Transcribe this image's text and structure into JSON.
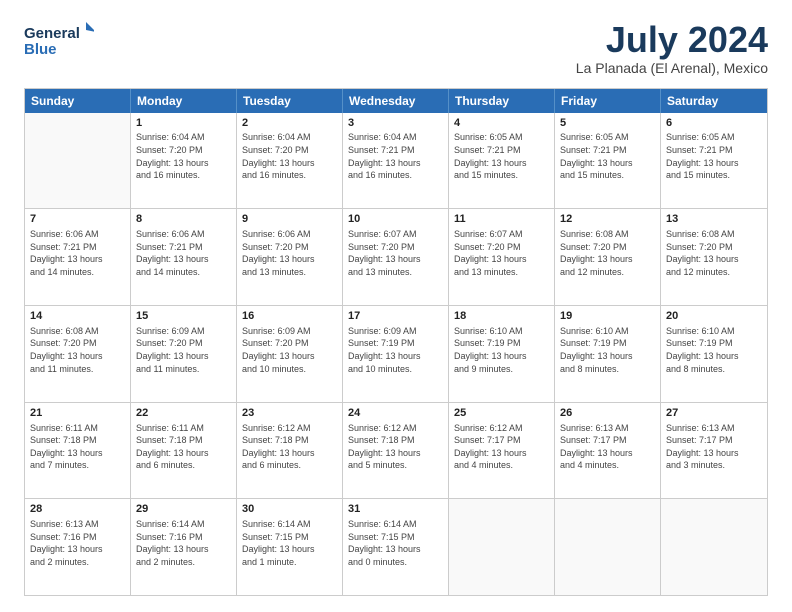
{
  "header": {
    "logo_line1": "General",
    "logo_line2": "Blue",
    "month_title": "July 2024",
    "location": "La Planada (El Arenal), Mexico"
  },
  "days": [
    "Sunday",
    "Monday",
    "Tuesday",
    "Wednesday",
    "Thursday",
    "Friday",
    "Saturday"
  ],
  "weeks": [
    [
      {
        "day": "",
        "info": ""
      },
      {
        "day": "1",
        "info": "Sunrise: 6:04 AM\nSunset: 7:20 PM\nDaylight: 13 hours\nand 16 minutes."
      },
      {
        "day": "2",
        "info": "Sunrise: 6:04 AM\nSunset: 7:20 PM\nDaylight: 13 hours\nand 16 minutes."
      },
      {
        "day": "3",
        "info": "Sunrise: 6:04 AM\nSunset: 7:21 PM\nDaylight: 13 hours\nand 16 minutes."
      },
      {
        "day": "4",
        "info": "Sunrise: 6:05 AM\nSunset: 7:21 PM\nDaylight: 13 hours\nand 15 minutes."
      },
      {
        "day": "5",
        "info": "Sunrise: 6:05 AM\nSunset: 7:21 PM\nDaylight: 13 hours\nand 15 minutes."
      },
      {
        "day": "6",
        "info": "Sunrise: 6:05 AM\nSunset: 7:21 PM\nDaylight: 13 hours\nand 15 minutes."
      }
    ],
    [
      {
        "day": "7",
        "info": "Sunrise: 6:06 AM\nSunset: 7:21 PM\nDaylight: 13 hours\nand 14 minutes."
      },
      {
        "day": "8",
        "info": "Sunrise: 6:06 AM\nSunset: 7:21 PM\nDaylight: 13 hours\nand 14 minutes."
      },
      {
        "day": "9",
        "info": "Sunrise: 6:06 AM\nSunset: 7:20 PM\nDaylight: 13 hours\nand 13 minutes."
      },
      {
        "day": "10",
        "info": "Sunrise: 6:07 AM\nSunset: 7:20 PM\nDaylight: 13 hours\nand 13 minutes."
      },
      {
        "day": "11",
        "info": "Sunrise: 6:07 AM\nSunset: 7:20 PM\nDaylight: 13 hours\nand 13 minutes."
      },
      {
        "day": "12",
        "info": "Sunrise: 6:08 AM\nSunset: 7:20 PM\nDaylight: 13 hours\nand 12 minutes."
      },
      {
        "day": "13",
        "info": "Sunrise: 6:08 AM\nSunset: 7:20 PM\nDaylight: 13 hours\nand 12 minutes."
      }
    ],
    [
      {
        "day": "14",
        "info": "Sunrise: 6:08 AM\nSunset: 7:20 PM\nDaylight: 13 hours\nand 11 minutes."
      },
      {
        "day": "15",
        "info": "Sunrise: 6:09 AM\nSunset: 7:20 PM\nDaylight: 13 hours\nand 11 minutes."
      },
      {
        "day": "16",
        "info": "Sunrise: 6:09 AM\nSunset: 7:20 PM\nDaylight: 13 hours\nand 10 minutes."
      },
      {
        "day": "17",
        "info": "Sunrise: 6:09 AM\nSunset: 7:19 PM\nDaylight: 13 hours\nand 10 minutes."
      },
      {
        "day": "18",
        "info": "Sunrise: 6:10 AM\nSunset: 7:19 PM\nDaylight: 13 hours\nand 9 minutes."
      },
      {
        "day": "19",
        "info": "Sunrise: 6:10 AM\nSunset: 7:19 PM\nDaylight: 13 hours\nand 8 minutes."
      },
      {
        "day": "20",
        "info": "Sunrise: 6:10 AM\nSunset: 7:19 PM\nDaylight: 13 hours\nand 8 minutes."
      }
    ],
    [
      {
        "day": "21",
        "info": "Sunrise: 6:11 AM\nSunset: 7:18 PM\nDaylight: 13 hours\nand 7 minutes."
      },
      {
        "day": "22",
        "info": "Sunrise: 6:11 AM\nSunset: 7:18 PM\nDaylight: 13 hours\nand 6 minutes."
      },
      {
        "day": "23",
        "info": "Sunrise: 6:12 AM\nSunset: 7:18 PM\nDaylight: 13 hours\nand 6 minutes."
      },
      {
        "day": "24",
        "info": "Sunrise: 6:12 AM\nSunset: 7:18 PM\nDaylight: 13 hours\nand 5 minutes."
      },
      {
        "day": "25",
        "info": "Sunrise: 6:12 AM\nSunset: 7:17 PM\nDaylight: 13 hours\nand 4 minutes."
      },
      {
        "day": "26",
        "info": "Sunrise: 6:13 AM\nSunset: 7:17 PM\nDaylight: 13 hours\nand 4 minutes."
      },
      {
        "day": "27",
        "info": "Sunrise: 6:13 AM\nSunset: 7:17 PM\nDaylight: 13 hours\nand 3 minutes."
      }
    ],
    [
      {
        "day": "28",
        "info": "Sunrise: 6:13 AM\nSunset: 7:16 PM\nDaylight: 13 hours\nand 2 minutes."
      },
      {
        "day": "29",
        "info": "Sunrise: 6:14 AM\nSunset: 7:16 PM\nDaylight: 13 hours\nand 2 minutes."
      },
      {
        "day": "30",
        "info": "Sunrise: 6:14 AM\nSunset: 7:15 PM\nDaylight: 13 hours\nand 1 minute."
      },
      {
        "day": "31",
        "info": "Sunrise: 6:14 AM\nSunset: 7:15 PM\nDaylight: 13 hours\nand 0 minutes."
      },
      {
        "day": "",
        "info": ""
      },
      {
        "day": "",
        "info": ""
      },
      {
        "day": "",
        "info": ""
      }
    ]
  ]
}
